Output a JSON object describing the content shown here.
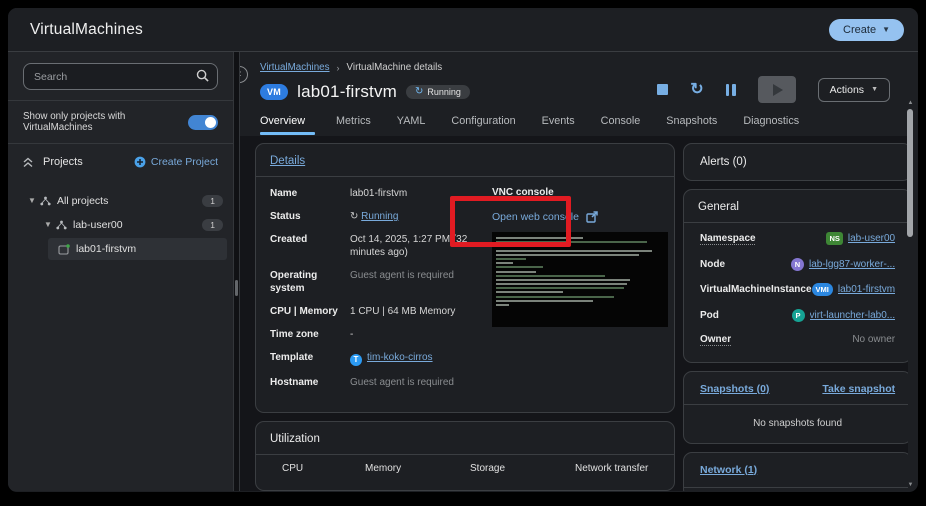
{
  "masthead": {
    "title": "VirtualMachines",
    "create_label": "Create"
  },
  "sidebar": {
    "search_placeholder": "Search",
    "filter_label": "Show only projects with VirtualMachines",
    "projects_header": "Projects",
    "create_project_label": "Create Project",
    "tree": [
      {
        "label": "All projects",
        "count": "1"
      },
      {
        "label": "lab-user00",
        "count": "1"
      },
      {
        "label": "lab01-firstvm"
      }
    ]
  },
  "header": {
    "breadcrumb": [
      "VirtualMachines",
      "VirtualMachine details"
    ],
    "kind_badge": "VM",
    "title": "lab01-firstvm",
    "status": "Running",
    "actions_label": "Actions"
  },
  "tabs": [
    "Overview",
    "Metrics",
    "YAML",
    "Configuration",
    "Events",
    "Console",
    "Snapshots",
    "Diagnostics"
  ],
  "details": {
    "heading": "Details",
    "rows": [
      {
        "label": "Name",
        "value": "lab01-firstvm"
      },
      {
        "label": "Status",
        "value": "Running"
      },
      {
        "label": "Created",
        "value": "Oct 14, 2025, 1:27 PM (32 minutes ago)"
      },
      {
        "label": "Operating system",
        "value": "Guest agent is required"
      },
      {
        "label": "CPU | Memory",
        "value": "1 CPU | 64 MB Memory"
      },
      {
        "label": "Time zone",
        "value": "-"
      },
      {
        "label": "Template",
        "value": "tim-koko-cirros",
        "badge": "T"
      },
      {
        "label": "Hostname",
        "value": "Guest agent is required"
      }
    ],
    "vnc": {
      "heading": "VNC console",
      "open_link": "Open web console"
    }
  },
  "utilization": {
    "heading": "Utilization",
    "columns": [
      "CPU",
      "Memory",
      "Storage",
      "Network transfer"
    ]
  },
  "alerts": {
    "heading": "Alerts (0)"
  },
  "general": {
    "heading": "General",
    "rows": [
      {
        "label": "Namespace",
        "badge": "NS",
        "value": "lab-user00"
      },
      {
        "label": "Node",
        "badge": "N",
        "value": "lab-lgg87-worker-..."
      },
      {
        "label": "VirtualMachineInstance",
        "badge": "VMI",
        "value": "lab01-firstvm"
      },
      {
        "label": "Pod",
        "badge": "P",
        "value": "virt-launcher-lab0..."
      },
      {
        "label": "Owner",
        "value": "No owner"
      }
    ]
  },
  "snapshots": {
    "heading": "Snapshots (0)",
    "action_label": "Take snapshot",
    "empty_text": "No snapshots found"
  },
  "network": {
    "heading": "Network (1)"
  },
  "colors": {
    "accent_blue": "#73bcf7",
    "link_blue": "#79aadb",
    "create_button": "#95c2f0",
    "vm_badge": "#2d7ce0",
    "namespace_badge": "#3e8635",
    "node_badge": "#8476d1",
    "vmi_badge": "#2b87e0",
    "pod_badge": "#16a394",
    "template_badge": "#2b9af3",
    "annotation_red": "#e11b22"
  }
}
